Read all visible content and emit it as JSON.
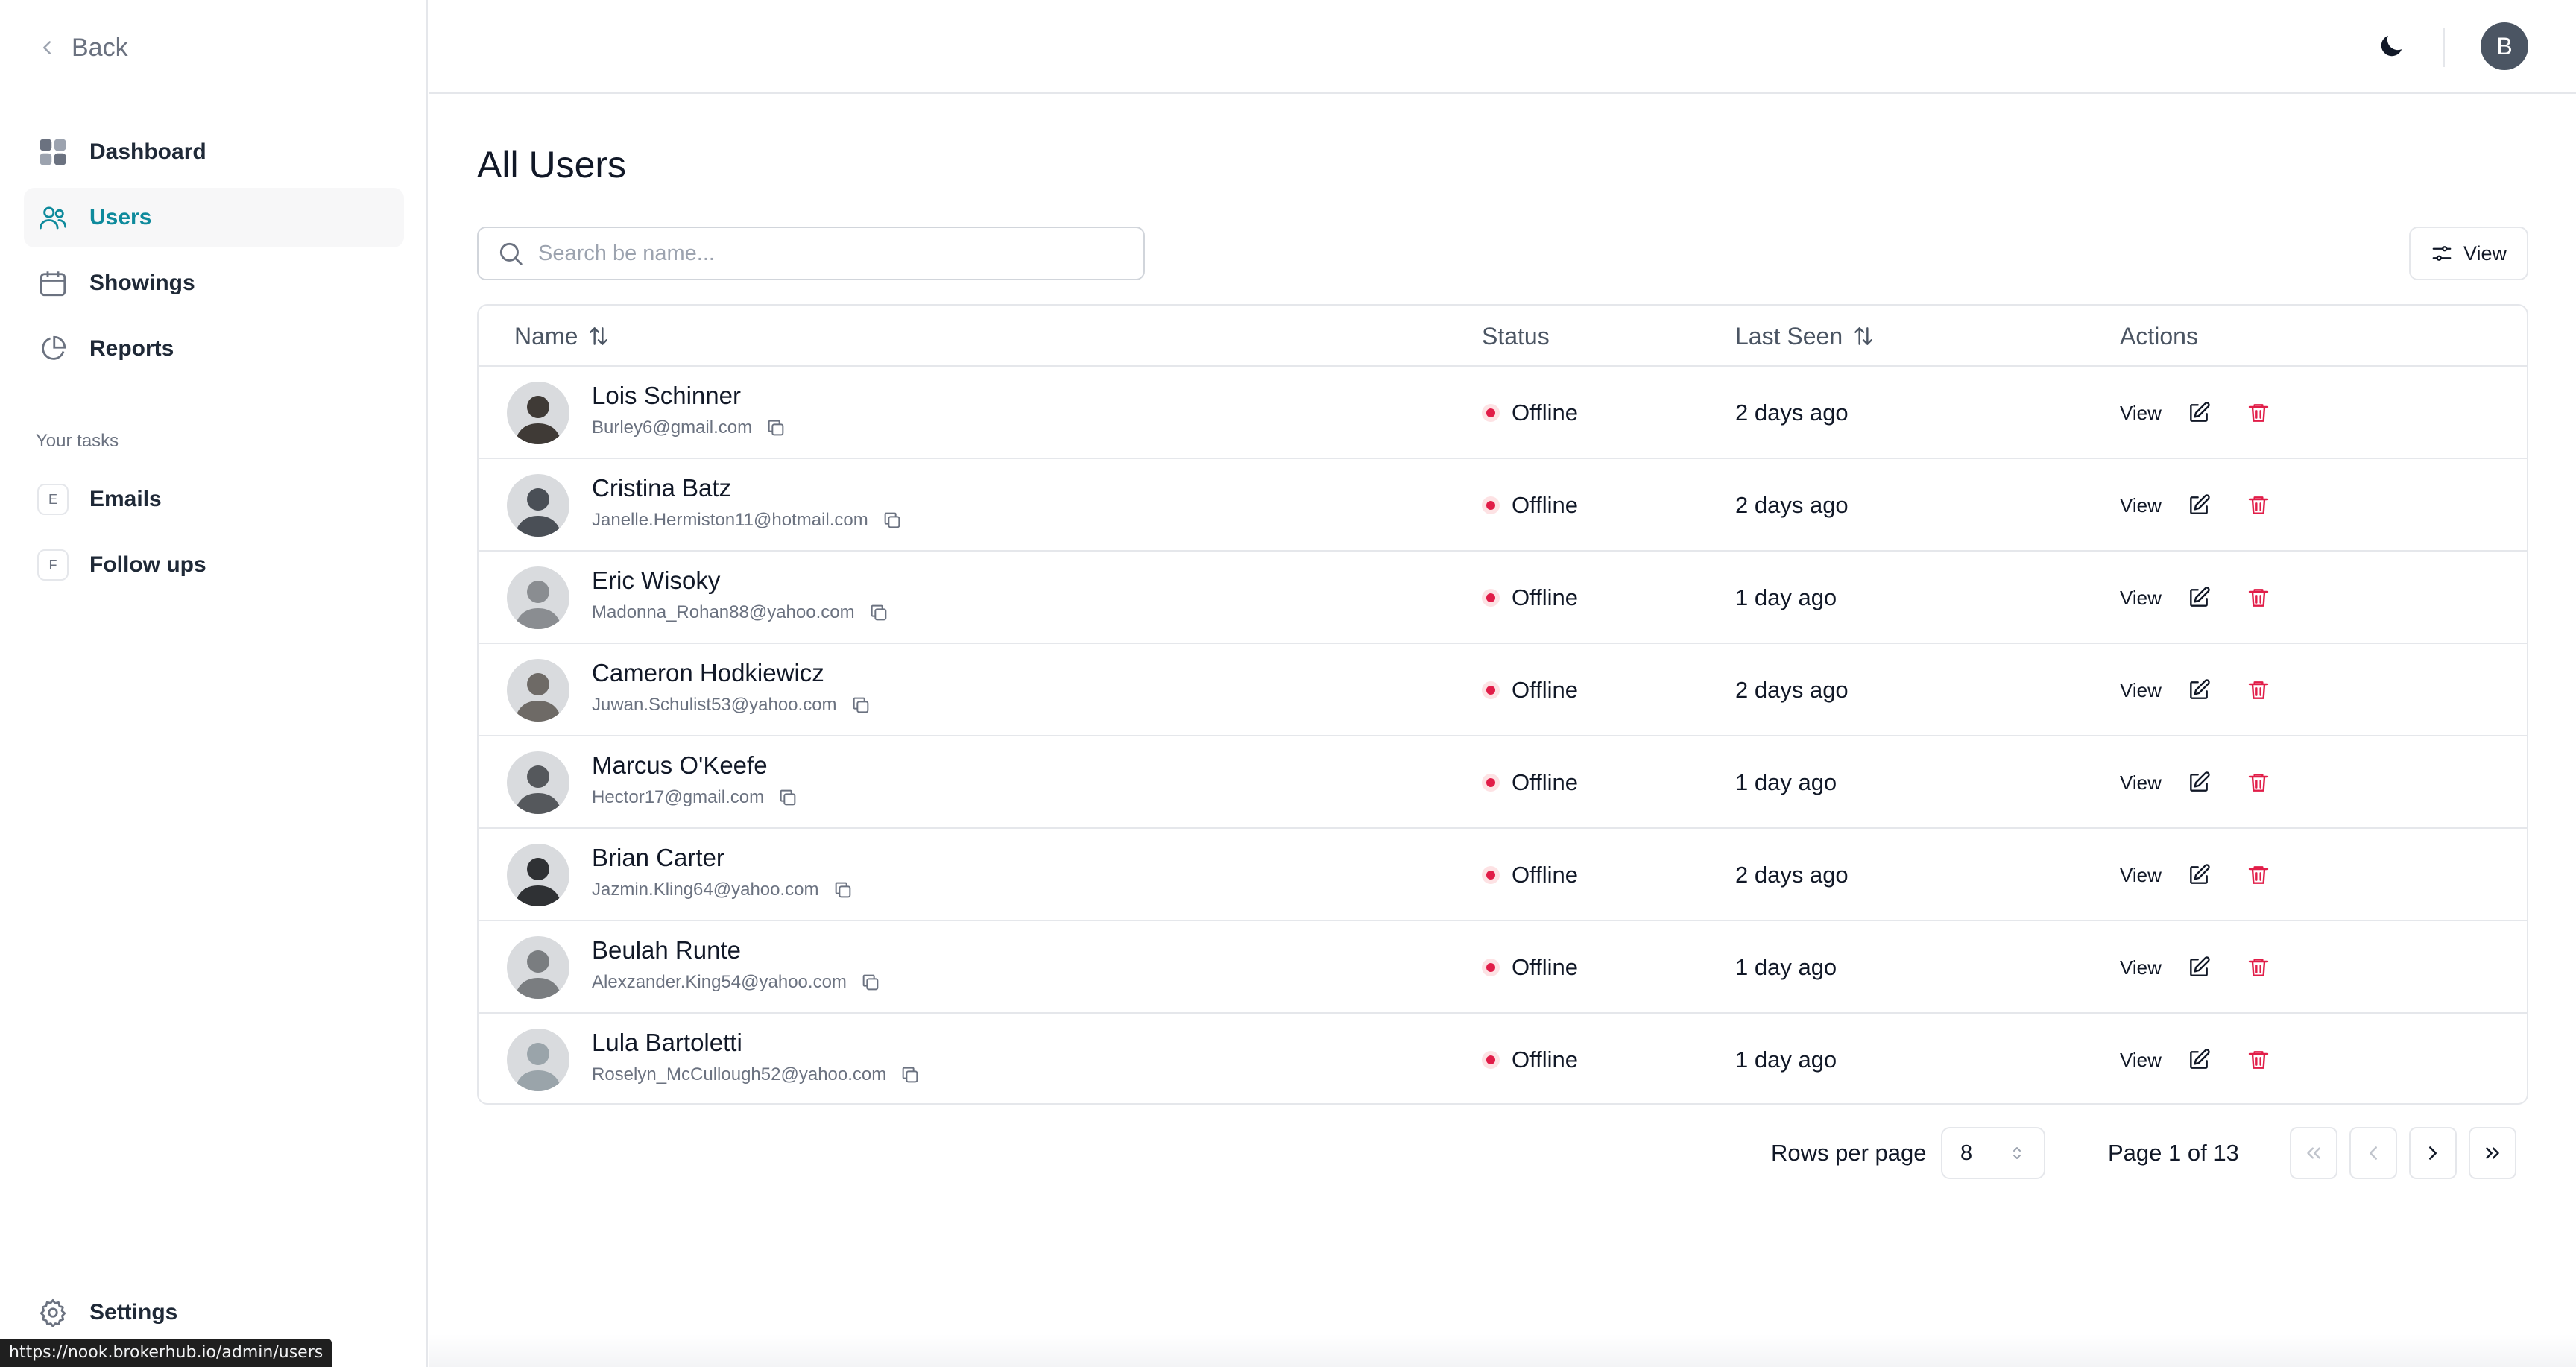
{
  "sidebar": {
    "back_label": "Back",
    "nav": [
      {
        "label": "Dashboard",
        "icon": "grid-icon"
      },
      {
        "label": "Users",
        "icon": "users-icon"
      },
      {
        "label": "Showings",
        "icon": "calendar-icon"
      },
      {
        "label": "Reports",
        "icon": "pie-chart-icon"
      }
    ],
    "active_nav": "Users",
    "tasks_label": "Your tasks",
    "tasks": [
      {
        "badge": "E",
        "label": "Emails"
      },
      {
        "badge": "F",
        "label": "Follow ups"
      }
    ],
    "settings_label": "Settings",
    "status_url": "https://nook.brokerhub.io/admin/users"
  },
  "header": {
    "avatar_initial": "B",
    "theme_icon": "moon-icon"
  },
  "main": {
    "title": "All Users",
    "search_placeholder": "Search be name...",
    "view_button": "View",
    "columns": {
      "name": "Name",
      "status": "Status",
      "last_seen": "Last Seen",
      "actions": "Actions"
    },
    "action_view_label": "View",
    "users": [
      {
        "name": "Lois Schinner",
        "email": "Burley6@gmail.com",
        "status": "Offline",
        "last_seen": "2 days ago"
      },
      {
        "name": "Cristina Batz",
        "email": "Janelle.Hermiston11@hotmail.com",
        "status": "Offline",
        "last_seen": "2 days ago"
      },
      {
        "name": "Eric Wisoky",
        "email": "Madonna_Rohan88@yahoo.com",
        "status": "Offline",
        "last_seen": "1 day ago"
      },
      {
        "name": "Cameron Hodkiewicz",
        "email": "Juwan.Schulist53@yahoo.com",
        "status": "Offline",
        "last_seen": "2 days ago"
      },
      {
        "name": "Marcus O'Keefe",
        "email": "Hector17@gmail.com",
        "status": "Offline",
        "last_seen": "1 day ago"
      },
      {
        "name": "Brian Carter",
        "email": "Jazmin.Kling64@yahoo.com",
        "status": "Offline",
        "last_seen": "2 days ago"
      },
      {
        "name": "Beulah Runte",
        "email": "Alexzander.King54@yahoo.com",
        "status": "Offline",
        "last_seen": "1 day ago"
      },
      {
        "name": "Lula Bartoletti",
        "email": "Roselyn_McCullough52@yahoo.com",
        "status": "Offline",
        "last_seen": "1 day ago"
      }
    ],
    "pagination": {
      "rows_label": "Rows per page",
      "rows_value": "8",
      "page_label": "Page 1 of 13"
    }
  },
  "colors": {
    "accent": "#0e8a9c",
    "offline": "#e11d48",
    "delete": "#e11d48"
  }
}
